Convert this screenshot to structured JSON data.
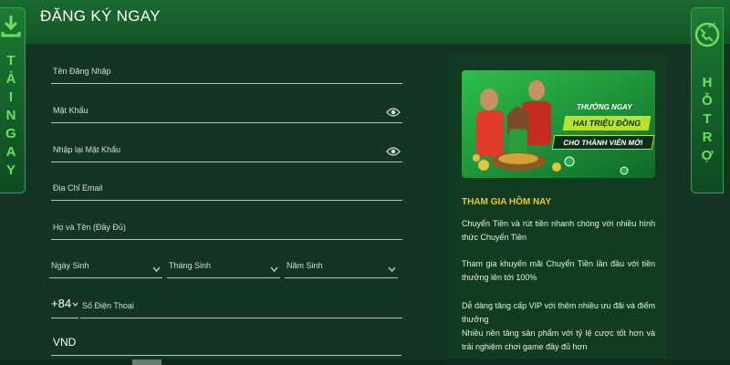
{
  "header": {
    "title": "ĐĂNG KÝ NGAY"
  },
  "left_banner": {
    "icon": "download-icon",
    "letters": [
      "T",
      "Ả",
      "I",
      "N",
      "G",
      "A",
      "Y"
    ]
  },
  "right_banner": {
    "icon": "support-24-icon",
    "badge": "24",
    "letters": [
      "H",
      "Ỗ",
      "T",
      "R",
      "Ợ"
    ]
  },
  "form": {
    "username_label": "Tên Đăng Nhập",
    "password_label": "Mật Khẩu",
    "confirm_password_label": "Nhập lại Mật Khẩu",
    "email_label": "Địa Chỉ Email",
    "fullname_label": "Họ và Tên (Đầy Đủ)",
    "birth_day_label": "Ngày Sinh",
    "birth_month_label": "Tháng Sinh",
    "birth_year_label": "Năm Sinh",
    "phone_code": "+84",
    "phone_label": "Số Điện Thoại",
    "currency": "VND"
  },
  "promo": {
    "banner_line1": "THƯỞNG NGAY",
    "banner_line2": "HAI TRIỆU ĐỒNG",
    "banner_line3": "CHO THÀNH VIÊN MỚI",
    "join_title": "THAM GIA HÔM NAY",
    "benefits": [
      "Chuyển Tiền và rút tiền nhanh chóng với nhiều hình thức Chuyển Tiền",
      "Tham gia khuyến mãi Chuyển Tiền lần đầu với tiền thưởng lên tới 100%",
      "Dễ dàng tăng cấp VIP với thêm nhiều ưu đãi và điểm thưởng",
      "Nhiều nền tảng sản phẩm với tỷ lệ cược tốt hơn và trải nghiệm chơi game đầy đủ hơn"
    ]
  },
  "colors": {
    "accent_green": "#6ee05a",
    "title_yellow": "#f5c518",
    "background": "#143524"
  }
}
